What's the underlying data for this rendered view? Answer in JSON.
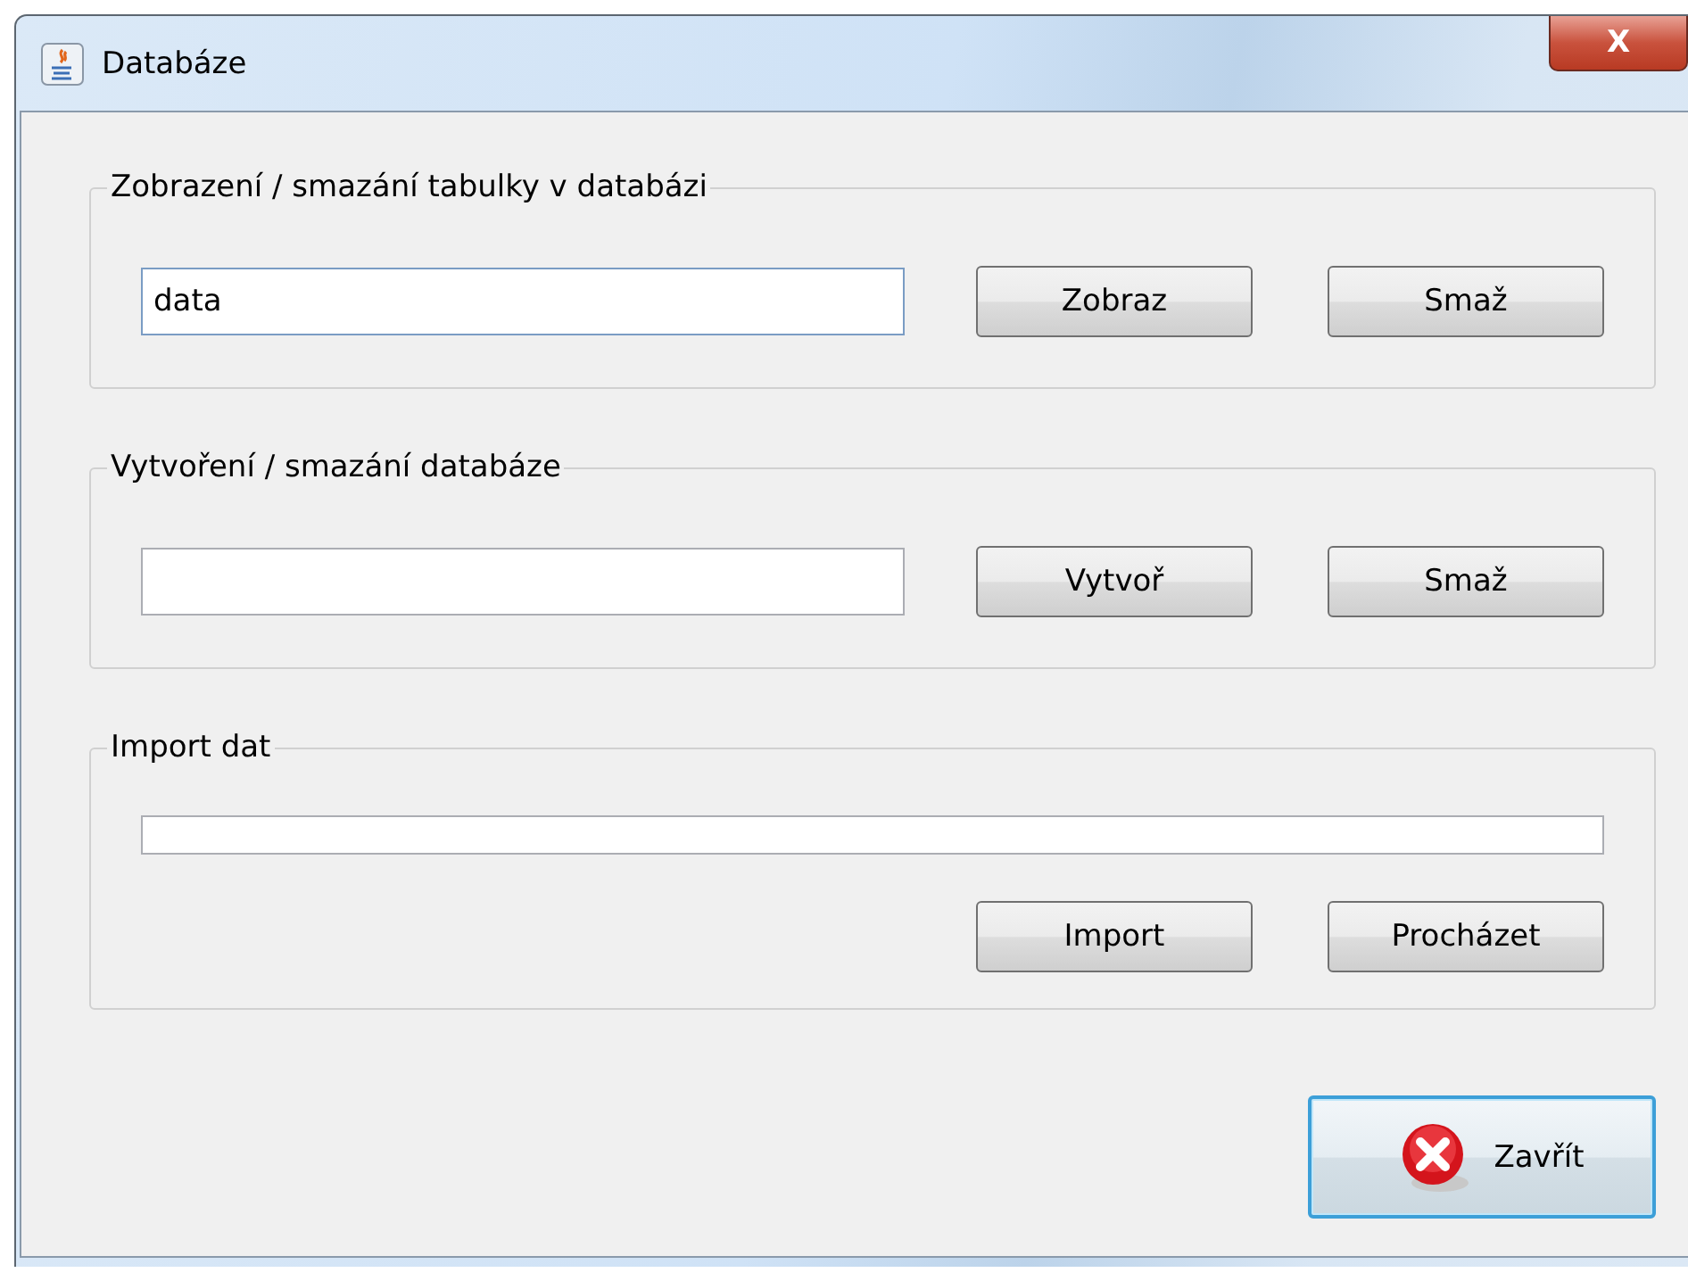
{
  "window": {
    "title": "Databáze",
    "close_label": "X"
  },
  "groups": [
    {
      "title": "Zobrazení / smazání tabulky v databázi",
      "kind": "inline",
      "field": {
        "value": "data",
        "focused": true
      },
      "buttons": [
        "Zobraz",
        "Smaž"
      ]
    },
    {
      "title": "Vytvoření / smazání databáze",
      "kind": "inline",
      "field": {
        "focused": false
      },
      "buttons": [
        "Vytvoř",
        "Smaž"
      ]
    },
    {
      "title": "Import dat",
      "kind": "stacked",
      "field": {
        "focused": false
      },
      "buttons": [
        "Import",
        "Procházet"
      ]
    }
  ],
  "close_button": {
    "label": "Zavřít",
    "default": true
  }
}
